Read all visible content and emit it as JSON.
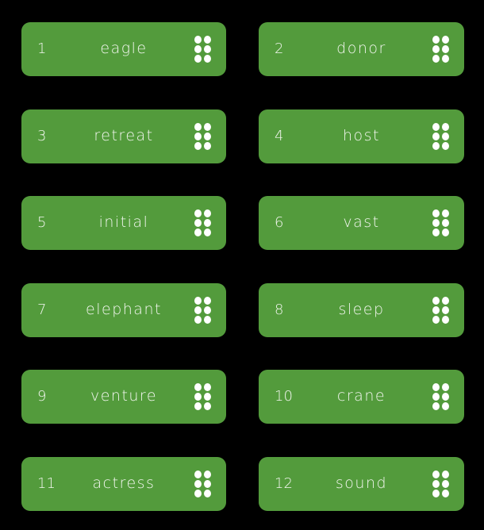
{
  "words": [
    {
      "index": "1",
      "word": "eagle"
    },
    {
      "index": "2",
      "word": "donor"
    },
    {
      "index": "3",
      "word": "retreat"
    },
    {
      "index": "4",
      "word": "host"
    },
    {
      "index": "5",
      "word": "initial"
    },
    {
      "index": "6",
      "word": "vast"
    },
    {
      "index": "7",
      "word": "elephant"
    },
    {
      "index": "8",
      "word": "sleep"
    },
    {
      "index": "9",
      "word": "venture"
    },
    {
      "index": "10",
      "word": "crane"
    },
    {
      "index": "11",
      "word": "actress"
    },
    {
      "index": "12",
      "word": "sound"
    }
  ],
  "colors": {
    "card": "#539b3c",
    "background": "#000000",
    "text": "#f2f6ef"
  },
  "icons": {
    "handle": "drag-handle-icon"
  }
}
